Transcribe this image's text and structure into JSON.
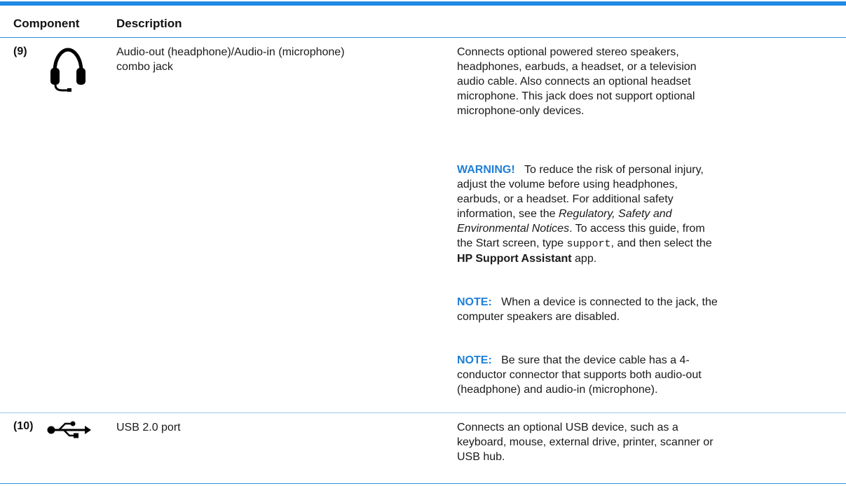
{
  "table": {
    "header": {
      "component": "Component",
      "description": "Description"
    },
    "rows": [
      {
        "number": "(9)",
        "icon": "headphone-icon",
        "label_line1": "Audio-out (headphone)/Audio-in (microphone)",
        "label_line2": "combo jack",
        "description_lines": [
          "Connects optional powered stereo speakers,",
          "headphones, earbuds, a headset, or a television",
          "audio cable. Also connects an optional headset",
          "microphone. This jack does not support optional",
          "microphone-only devices."
        ],
        "warning": {
          "label": "WARNING!",
          "l1": "To reduce the risk of personal injury,",
          "l2": "adjust the volume before using headphones,",
          "l3": "earbuds, or a headset. For additional safety",
          "l4a": "information, see the ",
          "l4_italic": "Regulatory, Safety and",
          "l5_italic": "Environmental Notices",
          "l5b": ". To access this guide, from",
          "l6a": "the Start screen, type ",
          "l6_code": "support",
          "l6b": ", and then select the",
          "l7_bold": "HP Support Assistant",
          "l7b": " app."
        },
        "note1": {
          "label": "NOTE:",
          "l1": "When a device is connected to the jack, the",
          "l2": "computer speakers are disabled."
        },
        "note2": {
          "label": "NOTE:",
          "l1": "Be sure that the device cable has a 4-",
          "l2": "conductor connector that supports both audio-out",
          "l3": "(headphone) and audio-in (microphone)."
        }
      },
      {
        "number": "(10)",
        "icon": "usb-icon",
        "label": "USB 2.0 port",
        "description_lines": [
          "Connects an optional USB device, such as a",
          "keyboard, mouse, external drive, printer, scanner or",
          "USB hub."
        ]
      }
    ]
  },
  "colors": {
    "accent": "#1f8ae6",
    "note_blue": "#1f7fd6"
  }
}
